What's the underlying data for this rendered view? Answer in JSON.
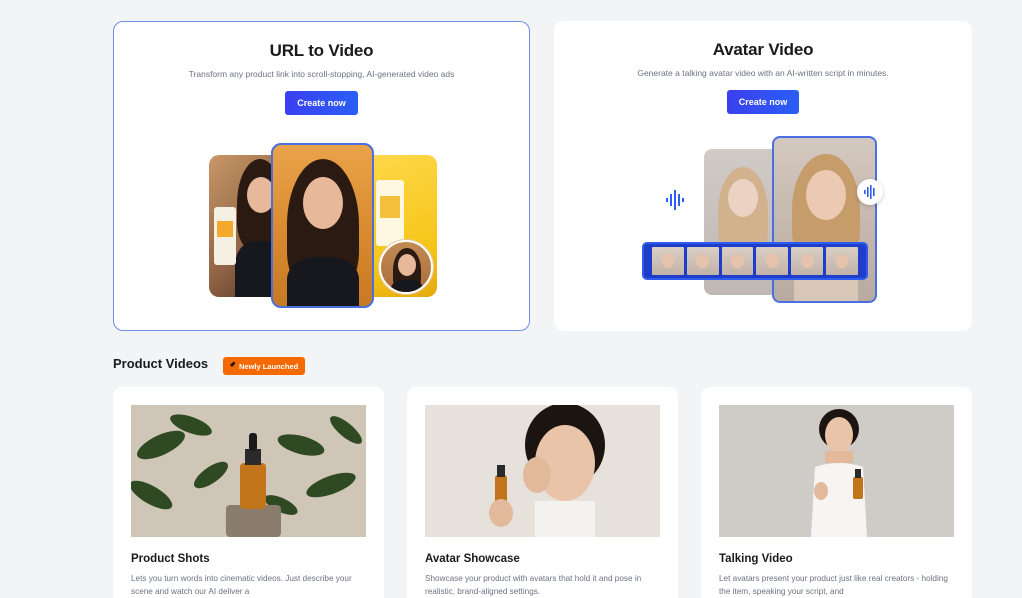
{
  "hero_cards": [
    {
      "title": "URL to Video",
      "description": "Transform any product link into scroll-stopping, AI-generated video ads",
      "cta": "Create now"
    },
    {
      "title": "Avatar Video",
      "description": "Generate a talking avatar video with an AI-written script in minutes.",
      "cta": "Create now"
    }
  ],
  "product_section": {
    "title": "Product Videos",
    "badge": "Newly Launched",
    "badge_color": "#f56a00"
  },
  "product_cards": [
    {
      "title": "Product Shots",
      "description": "Lets you turn words into cinematic videos. Just describe your scene and watch our AI deliver a"
    },
    {
      "title": "Avatar Showcase",
      "description": "Showcase your product with avatars that hold it and pose in realistic, brand-aligned settings."
    },
    {
      "title": "Talking Video",
      "description": "Let avatars present your product just like real creators - holding the item, speaking your script, and"
    }
  ],
  "colors": {
    "accent": "#3b3ff0",
    "selected_border": "#6d8fe8",
    "background": "#f3f4f6"
  }
}
